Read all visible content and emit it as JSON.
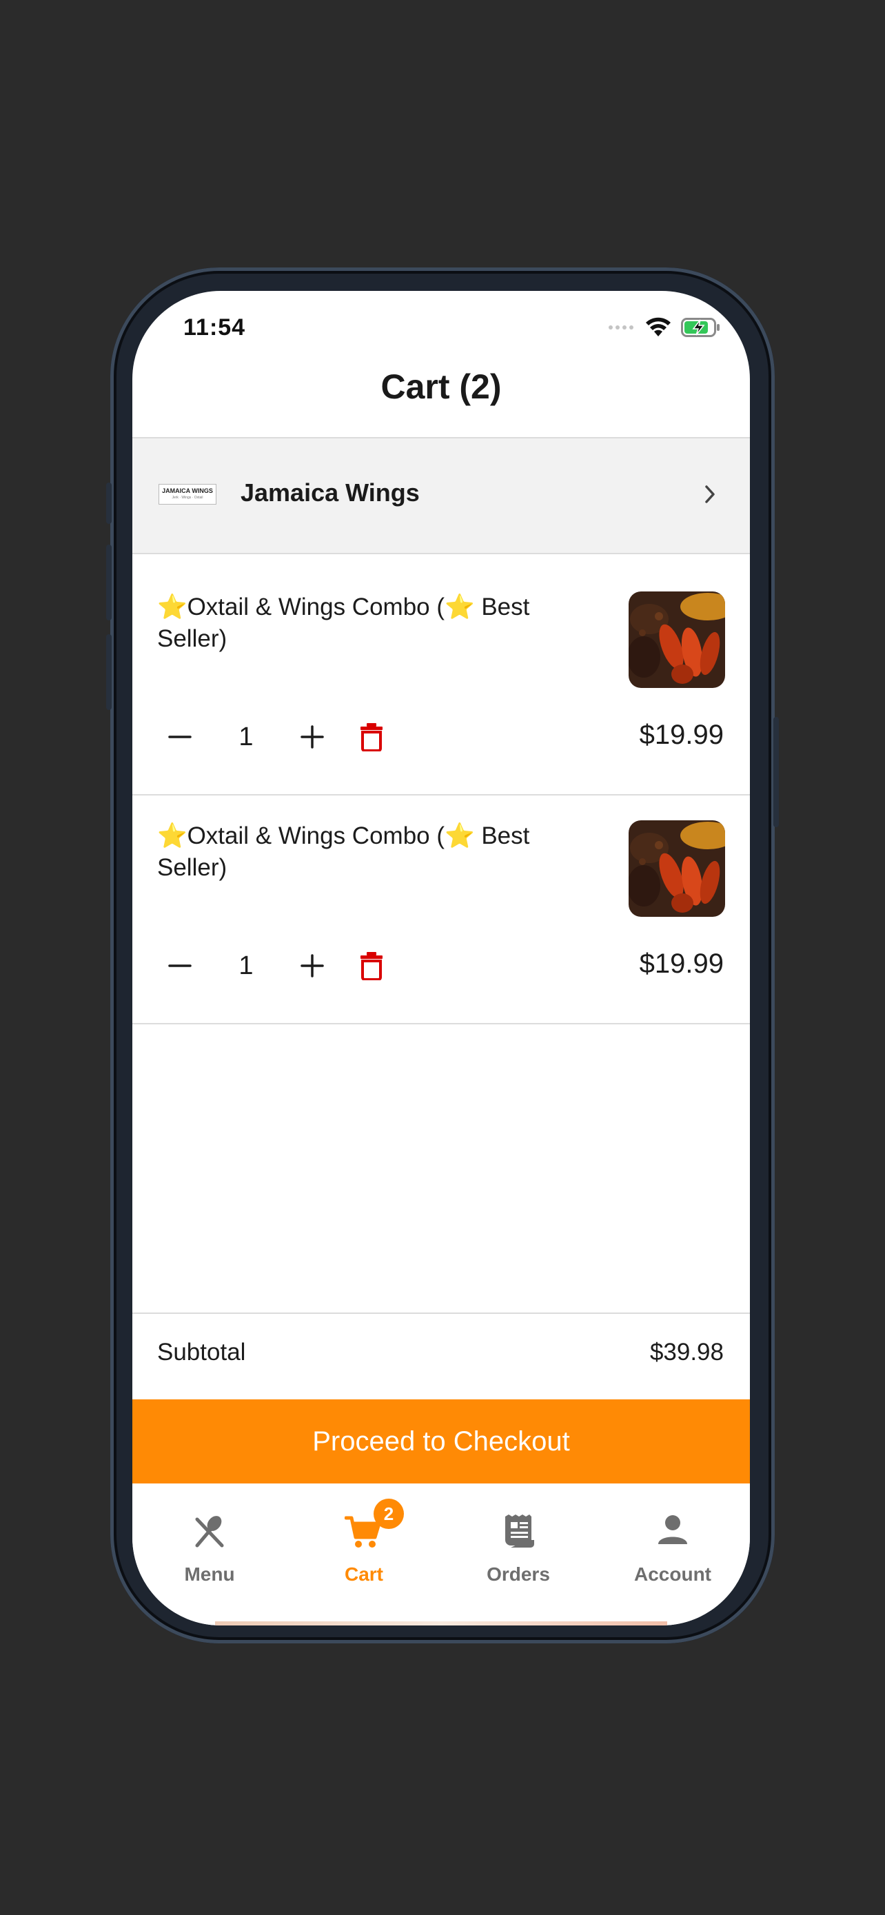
{
  "status_bar": {
    "time": "11:54"
  },
  "header": {
    "title": "Cart (2)"
  },
  "restaurant": {
    "name": "Jamaica Wings",
    "logo_text": "JAMAICA WINGS",
    "logo_subtext": "Jerk · Wings · Oxtail"
  },
  "cart_items": [
    {
      "title": "⭐Oxtail & Wings Combo (⭐ Best Seller)",
      "quantity": "1",
      "price": "$19.99"
    },
    {
      "title": "⭐Oxtail & Wings Combo (⭐ Best Seller)",
      "quantity": "1",
      "price": "$19.99"
    }
  ],
  "summary": {
    "subtotal_label": "Subtotal",
    "subtotal_value": "$39.98"
  },
  "checkout": {
    "label": "Proceed to Checkout"
  },
  "tabbar": {
    "tabs": [
      {
        "label": "Menu",
        "icon": "fork-knife-icon"
      },
      {
        "label": "Cart",
        "icon": "cart-icon",
        "badge": "2"
      },
      {
        "label": "Orders",
        "icon": "receipt-icon"
      },
      {
        "label": "Account",
        "icon": "person-icon"
      }
    ]
  },
  "colors": {
    "accent": "#ff8a05",
    "delete": "#d90000",
    "background": "#2b2b2b"
  }
}
